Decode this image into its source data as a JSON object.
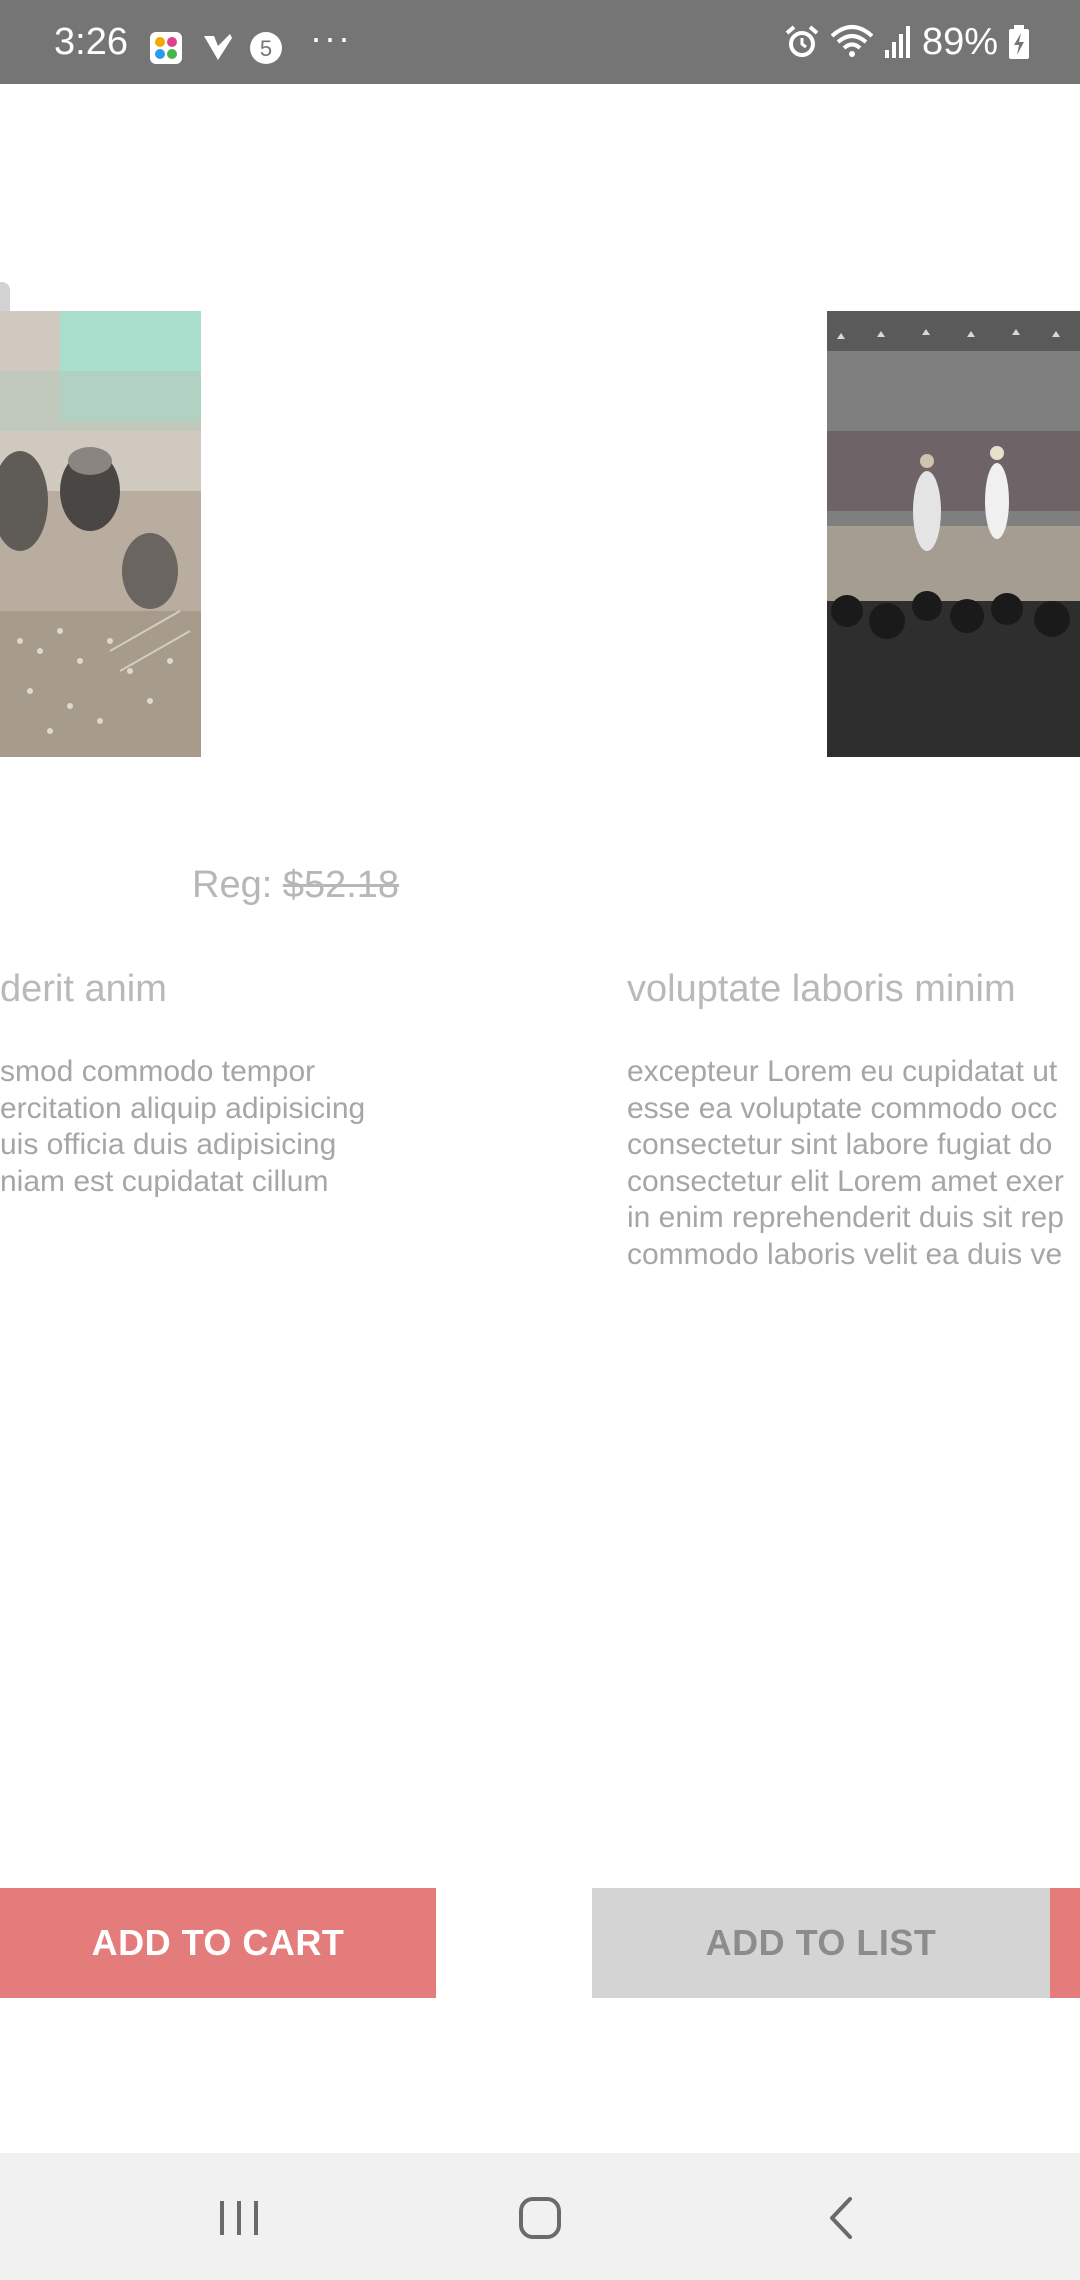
{
  "status_bar": {
    "time": "3:26",
    "battery": "89%",
    "more": "···",
    "icons": [
      "app-notification-icon",
      "check-notification-icon",
      "five-notification-icon",
      "alarm-icon",
      "wifi-icon",
      "signal-icon",
      "battery-charging-icon"
    ]
  },
  "products": [
    {
      "price_label": "Reg: ",
      "price_value": "$52.18",
      "title": "derit anim",
      "description_lines": [
        "smod commodo tempor",
        "ercitation aliquip adipisicing",
        "uis officia duis adipisicing",
        "niam est cupidatat cillum"
      ]
    },
    {
      "title": "voluptate laboris minim",
      "description_lines": [
        "excepteur Lorem eu cupidatat ut",
        "esse ea voluptate commodo occ",
        "consectetur sint labore fugiat do",
        "consectetur elit Lorem amet exer",
        "in enim reprehenderit duis sit rep",
        "commodo laboris velit ea duis ve"
      ]
    }
  ],
  "buttons": {
    "add_to_cart": "ADD TO CART",
    "add_to_list": "ADD TO LIST"
  },
  "colors": {
    "status_bar": "#757575",
    "cart_button": "#e57c7c",
    "list_button": "#d4d4d4",
    "nav_bar": "#f1f1f1"
  },
  "nav_bar": {
    "icons": [
      "recents-icon",
      "home-icon",
      "back-icon"
    ]
  }
}
